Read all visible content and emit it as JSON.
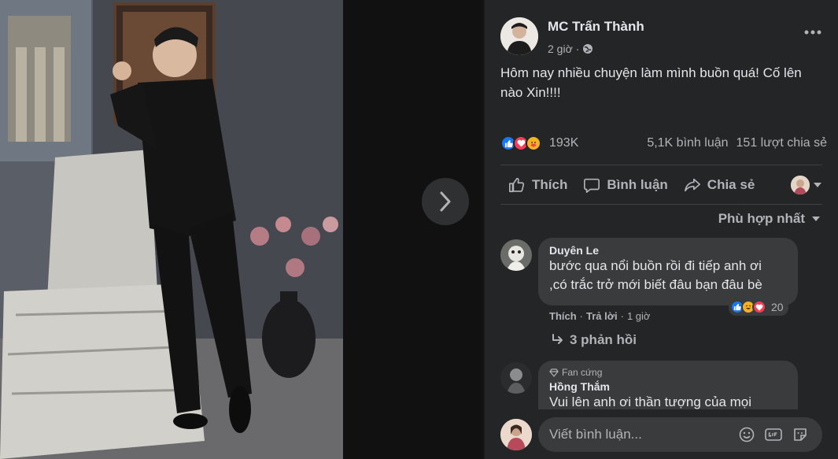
{
  "post": {
    "author": "MC Trấn Thành",
    "time": "2 giờ",
    "text": "Hôm nay nhiều chuyện làm mình buồn quá! Cố lên nào Xin!!!!",
    "reaction_count": "193K",
    "comment_count": "5,1K bình luận",
    "share_count": "151 lượt chia sẻ"
  },
  "actions": {
    "like": "Thích",
    "comment": "Bình luận",
    "share": "Chia sẻ"
  },
  "sort_label": "Phù hợp nhất",
  "comments": [
    {
      "name": "Duyên Le",
      "text_line1": "bước qua nổi buồn rồi đi tiếp anh ơi",
      "text_line2": ",có trắc trở mới biết đâu bạn đâu bè",
      "like": "Thích",
      "reply": "Trả lời",
      "time": "1 giờ",
      "reaction_count": "20",
      "replies": "3 phản hồi"
    },
    {
      "badge": "Fan cứng",
      "name": "Hồng Thắm",
      "text": "Vui lên anh ơi thần tượng của mọi"
    }
  ],
  "composer": {
    "placeholder": "Viết bình luận..."
  },
  "colors": {
    "panel_bg": "#242526",
    "bubble_bg": "#3a3b3c",
    "text_primary": "#e4e6eb",
    "text_secondary": "#b0b3b8",
    "like_blue": "#1877f2",
    "love_red": "#f33e58",
    "haha_yellow": "#f7b125"
  },
  "icons": [
    "chevron-right-icon",
    "globe-icon",
    "more-icon",
    "like-react-icon",
    "love-react-icon",
    "care-react-icon",
    "thumbs-up-icon",
    "comment-icon",
    "share-icon",
    "caret-down-icon",
    "reply-arrow-icon",
    "diamond-icon",
    "emoji-icon",
    "gif-icon",
    "sticker-icon"
  ]
}
